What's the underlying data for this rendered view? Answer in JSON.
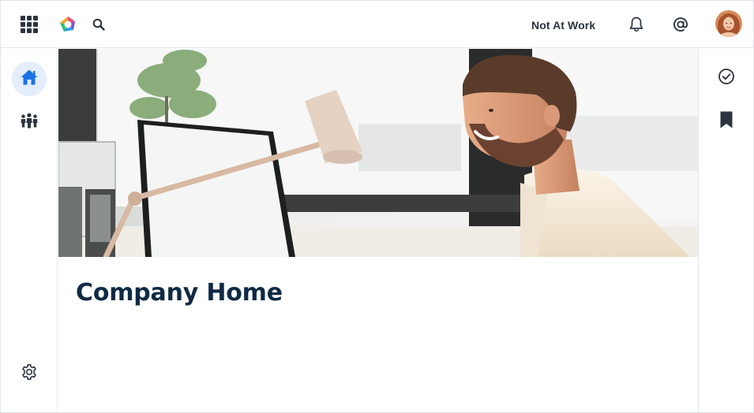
{
  "header": {
    "status_label": "Not At Work"
  },
  "icons": {
    "apps": "apps-grid-icon",
    "search": "search-icon",
    "notifications": "bell-icon",
    "mentions": "at-sign-icon",
    "home": "home-icon",
    "people": "people-icon",
    "settings": "gear-icon",
    "tasks": "check-circle-icon",
    "bookmarks": "bookmark-icon"
  },
  "main": {
    "title": "Company Home"
  },
  "colors": {
    "accent": "#1a73e8",
    "home_active_bg": "#e3edfb",
    "title": "#0f2a44",
    "icon_dark": "#2b3440"
  }
}
